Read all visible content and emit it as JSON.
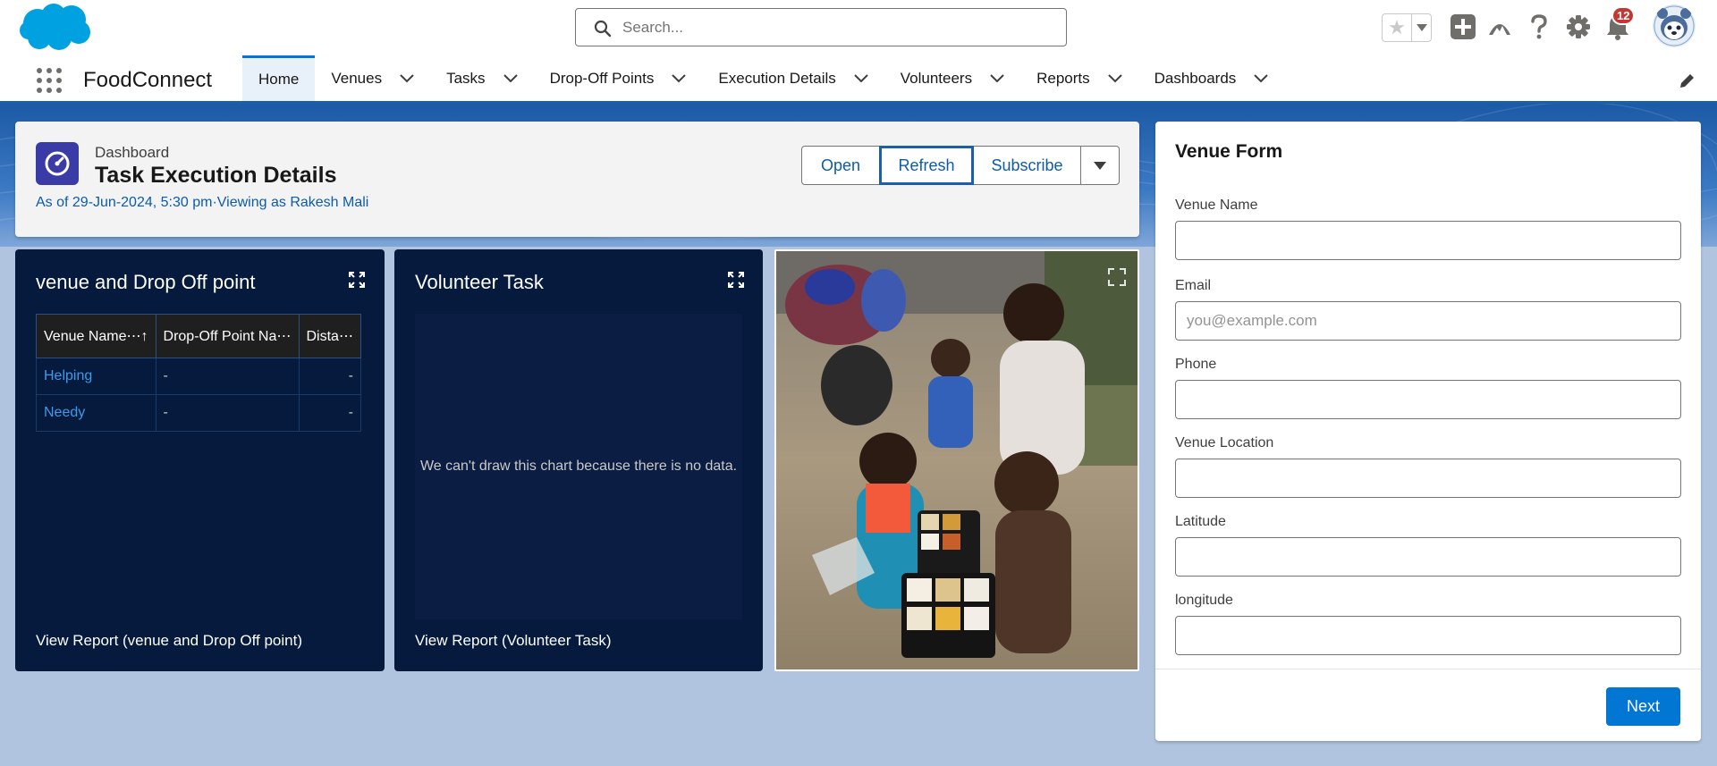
{
  "header": {
    "search": {
      "placeholder": "Search...",
      "value": ""
    },
    "notifications_count": "12",
    "icons": [
      "salesforce-cloud-icon",
      "search-icon",
      "star-icon",
      "chevron-down-icon",
      "add-icon",
      "trailhead-icon",
      "help-icon",
      "gear-icon",
      "bell-icon",
      "avatar"
    ]
  },
  "nav": {
    "app_name": "FoodConnect",
    "items": [
      {
        "label": "Home",
        "active": true
      },
      {
        "label": "Venues"
      },
      {
        "label": "Tasks"
      },
      {
        "label": "Drop-Off Points"
      },
      {
        "label": "Execution Details"
      },
      {
        "label": "Volunteers"
      },
      {
        "label": "Reports"
      },
      {
        "label": "Dashboards"
      }
    ]
  },
  "dashboard": {
    "type_label": "Dashboard",
    "title": "Task Execution Details",
    "meta": "As of 29-Jun-2024, 5:30 pm·Viewing as Rakesh Mali",
    "buttons": {
      "open": "Open",
      "refresh": "Refresh",
      "subscribe": "Subscribe"
    }
  },
  "widgets": {
    "venue_drop": {
      "title": "venue and Drop Off point",
      "columns": [
        "Venue Name⋯↑",
        "Drop-Off Point Na⋯",
        "Dista⋯"
      ],
      "rows": [
        [
          "Helping",
          "-",
          "-"
        ],
        [
          "Needy",
          "-",
          "-"
        ]
      ],
      "footer": "View Report (venue and Drop Off point)"
    },
    "volunteer_task": {
      "title": "Volunteer Task",
      "no_data": "We can't draw this chart because there is no data.",
      "footer": "View Report (Volunteer Task)"
    }
  },
  "venue_form": {
    "title": "Venue Form",
    "fields": [
      {
        "label": "Venue Name",
        "placeholder": "",
        "value": ""
      },
      {
        "label": "Email",
        "placeholder": "you@example.com",
        "value": ""
      },
      {
        "label": "Phone",
        "placeholder": "",
        "value": ""
      },
      {
        "label": "Venue Location",
        "placeholder": "",
        "value": ""
      },
      {
        "label": "Latitude",
        "placeholder": "",
        "value": ""
      },
      {
        "label": "longitude",
        "placeholder": "",
        "value": ""
      }
    ],
    "next_label": "Next"
  },
  "colors": {
    "brand_blue": "#0176d3",
    "nav_underline": "#1b5fa8",
    "widget_bg": "#051a3d",
    "dashboard_icon": "#3b3ba8",
    "notification_badge": "#c23934"
  }
}
